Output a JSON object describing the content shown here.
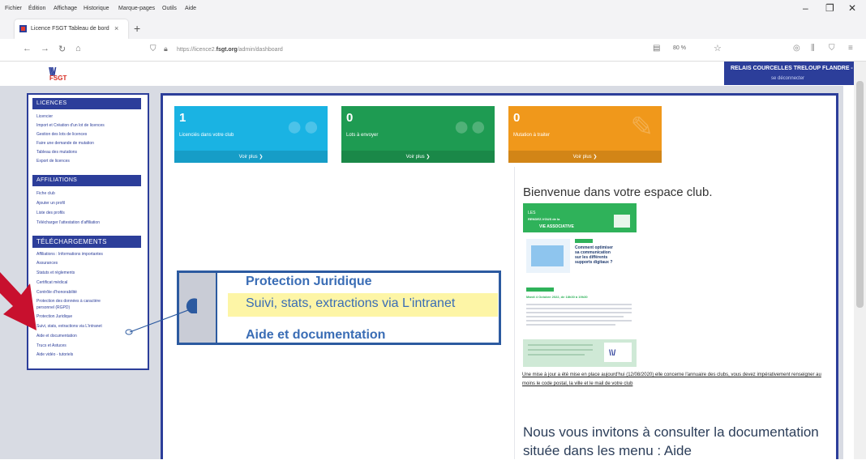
{
  "browser": {
    "menu": [
      "Fichier",
      "Édition",
      "Affichage",
      "Historique",
      "Marque-pages",
      "Outils",
      "Aide"
    ],
    "tab_title": "Licence FSGT Tableau de bord",
    "url_prefix": "https://licence2.",
    "url_domain": "fsgt.org",
    "url_path": "/admin/dashboard",
    "zoom": "80 %"
  },
  "header": {
    "logo_text": "FSGT",
    "club_name": "RELAIS COURCELLES TRELOUP FLANDRE -",
    "club_sub": "se déconnecter"
  },
  "sidebar": {
    "sections": [
      {
        "title": "Licences",
        "items": [
          "Licencier",
          "Import et Création d'un lot de licences",
          "Gestion des lots de licences",
          "Faire une demande de mutation",
          "Tableau des mutations",
          "Export de licences"
        ]
      },
      {
        "title": "Affiliations",
        "items": [
          "Fiche club",
          "Ajouter un profil",
          "Liste des profils",
          "Télécharger l'attestation d'affiliation"
        ]
      },
      {
        "title": "Téléchargements",
        "items": [
          "Affiliations : Informations importantes",
          "Assurances",
          "Statuts et règlements",
          "Certificat médical",
          "Contrôle d'honorabilité",
          "Protection des données à caractère",
          "personnel (RGPD)",
          "Protection Juridique",
          "Suivi, stats, extractions via L'intranet",
          "Aide et documentation",
          "Trucs et Astuces",
          "Aide vidéo - tutoriels"
        ]
      }
    ]
  },
  "cards": [
    {
      "number": "1",
      "label": "Licenciés dans votre club",
      "footer": "Voir plus ❯",
      "color": "#1ab3e3"
    },
    {
      "number": "0",
      "label": "Lots à envoyer",
      "footer": "Voir plus ❯",
      "color": "#1e9b52"
    },
    {
      "number": "0",
      "label": "Mutation à traiter",
      "footer": "Voir plus ❯",
      "color": "#f0981b"
    }
  ],
  "welcome": {
    "title": "Bienvenue dans votre espace club.",
    "update_text": "Une mise à jour a été mise en place aujourd'hui (12/08/2020) elle concerne l'annuaire des clubs, vous devez impérativement renseigner au moins le code postal, la ville et le mail de votre club",
    "invite_text": "Nous vous invitons à consulter la documentation située dans les menu : Aide"
  },
  "newsletter": {
    "banner_line1": "LES",
    "banner_line2": "RENDEZ-VOUS de la",
    "banner_line3": "VIE ASSOCIATIVE",
    "headline": "Comment optimiser sa communication sur les différents supports digitaux ?",
    "date_line": "Mardi 4 Octobre 2022, de 18h30 à 19h30"
  },
  "zoom_callout": {
    "line1": "Protection Juridique",
    "line2": "Suivi, stats, extractions via L'intranet",
    "line3": "Aide et documentation"
  },
  "colors": {
    "brand": "#2c3e9a",
    "callout": "#2c5aa0",
    "highlight": "#fdf5a6",
    "arrow": "#c8102e"
  }
}
